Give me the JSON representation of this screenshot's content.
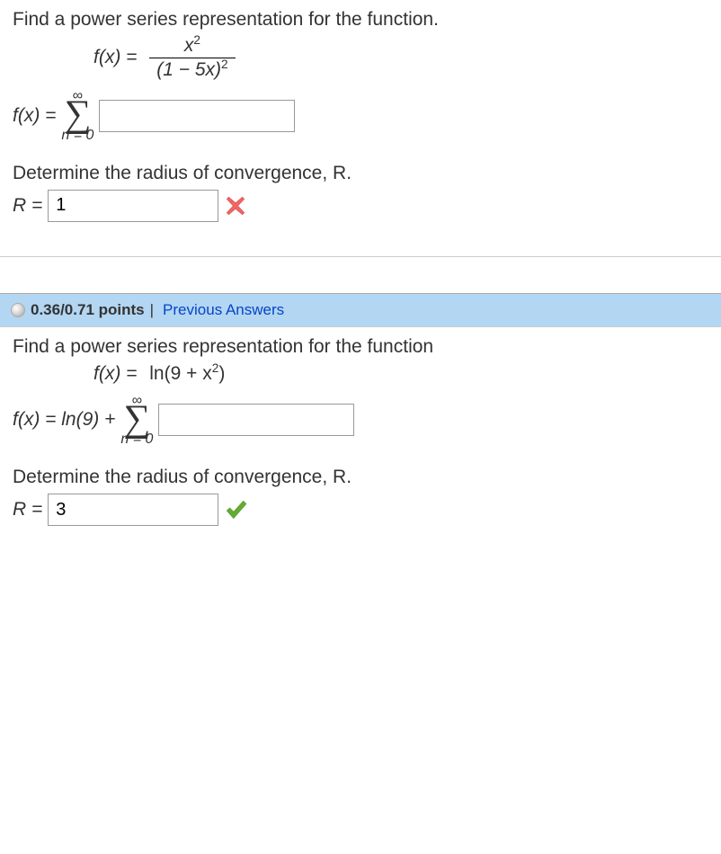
{
  "q1": {
    "prompt": "Find a power series representation for the function.",
    "func_label": "f(x) =",
    "numerator_a": "x",
    "numerator_exp": "2",
    "denominator_text": "(1 − 5x)",
    "denominator_exp": "2",
    "sum_label": "f(x) =",
    "sigma_top": "∞",
    "sigma_bottom": "n = 0",
    "series_answer": "",
    "radius_prompt": "Determine the radius of convergence, R.",
    "radius_label": "R =",
    "radius_value": "1",
    "radius_feedback": "incorrect"
  },
  "score": {
    "points": "0.36/0.71 points",
    "separator": "|",
    "link": "Previous Answers"
  },
  "q2": {
    "prompt": "Find a power series representation for the function",
    "func_label": "f(x) =",
    "func_rhs_a": "ln(9 + x",
    "func_rhs_exp": "2",
    "func_rhs_b": ")",
    "sum_label_a": "f(x) = ln(9) +",
    "sigma_top": "∞",
    "sigma_bottom": "n = 0",
    "series_answer": "",
    "radius_prompt": "Determine the radius of convergence, R.",
    "radius_label": "R =",
    "radius_value": "3",
    "radius_feedback": "correct"
  }
}
